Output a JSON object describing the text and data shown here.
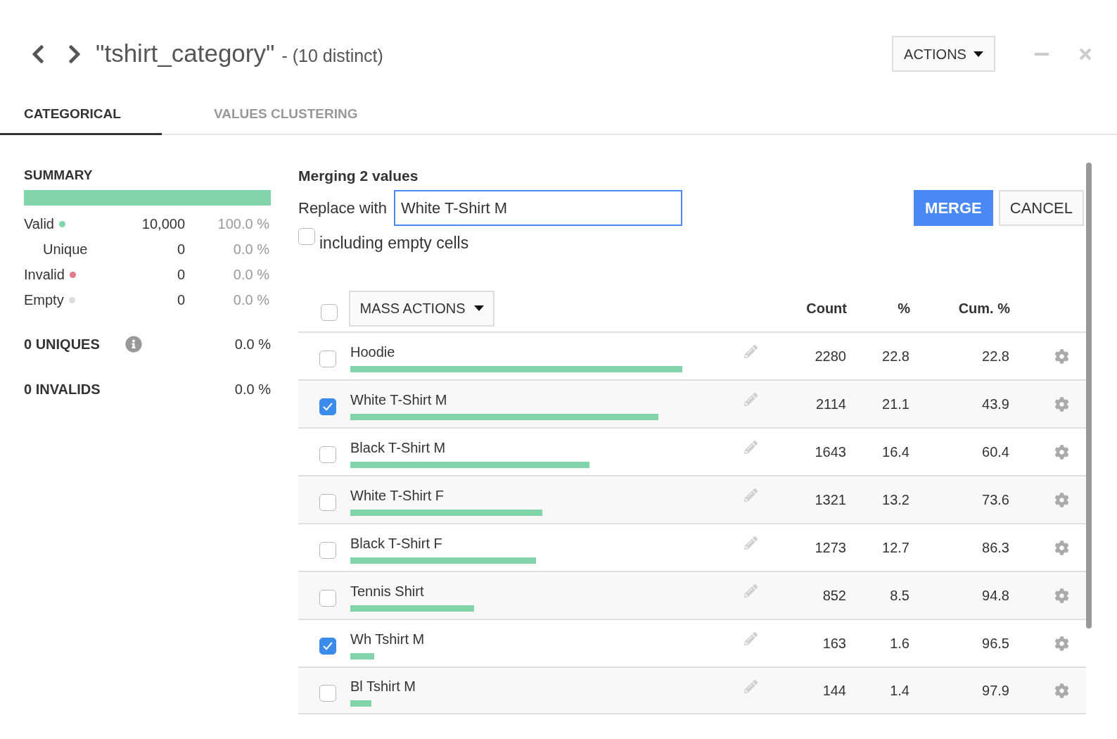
{
  "header": {
    "title": "\"tshirt_category\"",
    "subtitle": "- (10 distinct)",
    "actions_button": "ACTIONS"
  },
  "tabs": [
    {
      "label": "CATEGORICAL",
      "selected": true
    },
    {
      "label": "VALUES CLUSTERING",
      "selected": false
    }
  ],
  "summary": {
    "title": "SUMMARY",
    "bar": {
      "level": 1
    },
    "stats": [
      {
        "label": "Valid",
        "kind": "main",
        "color": "#81d5aa",
        "count": "10,000",
        "percent": "100.0 %"
      },
      {
        "label": "Unique",
        "kind": "sub",
        "count": "0",
        "percent": "0.0 %"
      },
      {
        "label": "Invalid",
        "kind": "main",
        "color": "#e07a86",
        "count": "0",
        "percent": "0.0 %"
      },
      {
        "label": "Empty",
        "kind": "main",
        "color": "#dddddd",
        "count": "0",
        "percent": "0.0 %"
      }
    ],
    "totals": [
      {
        "label": "0 UNIQUES",
        "info": true,
        "percent": "0.0 %"
      },
      {
        "label": "0 INVALIDS",
        "info": false,
        "percent": "0.0 %"
      }
    ]
  },
  "merge": {
    "title": "Merging 2 values",
    "replace_label": "Replace with",
    "replace_value": "White T-Shirt M",
    "including_empty": {
      "label": "including empty cells",
      "checked": false
    },
    "buttons": [
      {
        "label": "MERGE",
        "kind": "primary"
      },
      {
        "label": "CANCEL",
        "kind": "secondary"
      }
    ]
  },
  "table": {
    "select_all": {
      "checked": false
    },
    "mass_actions": "MASS ACTIONS",
    "columns": [
      "Count",
      "%",
      "Cum. %"
    ],
    "rows": [
      {
        "value": "Hoodie",
        "checked": false,
        "count": "2280",
        "percent": "22.8",
        "cumulative": "22.8"
      },
      {
        "value": "White T-Shirt M",
        "checked": true,
        "count": "2114",
        "percent": "21.1",
        "cumulative": "43.9"
      },
      {
        "value": "Black T-Shirt M",
        "checked": false,
        "count": "1643",
        "percent": "16.4",
        "cumulative": "60.4"
      },
      {
        "value": "White T-Shirt F",
        "checked": false,
        "count": "1321",
        "percent": "13.2",
        "cumulative": "73.6"
      },
      {
        "value": "Black T-Shirt F",
        "checked": false,
        "count": "1273",
        "percent": "12.7",
        "cumulative": "86.3"
      },
      {
        "value": "Tennis Shirt",
        "checked": false,
        "count": "852",
        "percent": "8.5",
        "cumulative": "94.8"
      },
      {
        "value": "Wh Tshirt M",
        "checked": true,
        "count": "163",
        "percent": "1.6",
        "cumulative": "96.5"
      },
      {
        "value": "Bl Tshirt M",
        "checked": false,
        "count": "144",
        "percent": "1.4",
        "cumulative": "97.9"
      }
    ]
  }
}
